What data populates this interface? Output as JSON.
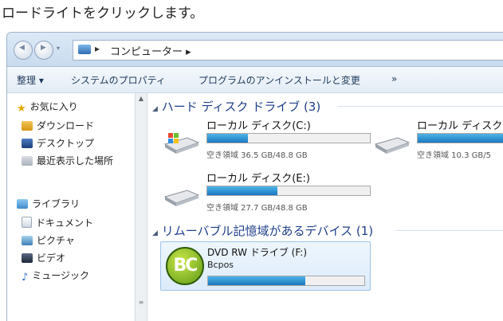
{
  "caption": "ロードライトをクリックします。",
  "window": {
    "breadcrumb": [
      "コンピューター"
    ],
    "toolbar": {
      "organize": "整理 ▾",
      "system_properties": "システムのプロパティ",
      "uninstall": "プログラムのアンインストールと変更",
      "more": "»"
    },
    "sidebar": {
      "favorites_label": "お気に入り",
      "favorites": [
        "ダウンロード",
        "デスクトップ",
        "最近表示した場所"
      ],
      "libraries_label": "ライブラリ",
      "libraries": [
        "ドキュメント",
        "ピクチャ",
        "ビデオ",
        "ミュージック"
      ]
    },
    "hdd_group": {
      "title": "ハード ディスク ドライブ (3)",
      "drives": [
        {
          "name": "ローカル ディスク(C:)",
          "free_text": "空き領域 36.5 GB/48.8 GB",
          "used_fraction": 0.25
        },
        {
          "name": "ローカル ディスク(D:)",
          "free_text": "空き領域 10.3 GB/5",
          "used_fraction": 0.8
        },
        {
          "name": "ローカル ディスク(E:)",
          "free_text": "空き領域 27.7 GB/48.8 GB",
          "used_fraction": 0.43
        }
      ]
    },
    "removable_group": {
      "title": "リムーバブル記憶域があるデバイス (1)",
      "device": {
        "name": "DVD RW ドライブ (F:)",
        "label": "Bcpos",
        "logo_text": "BC",
        "used_fraction": 0.62
      }
    }
  },
  "colors": {
    "accent": "#1a78c0",
    "group_title": "#1e3f8a",
    "selection": "#dcebfa"
  }
}
